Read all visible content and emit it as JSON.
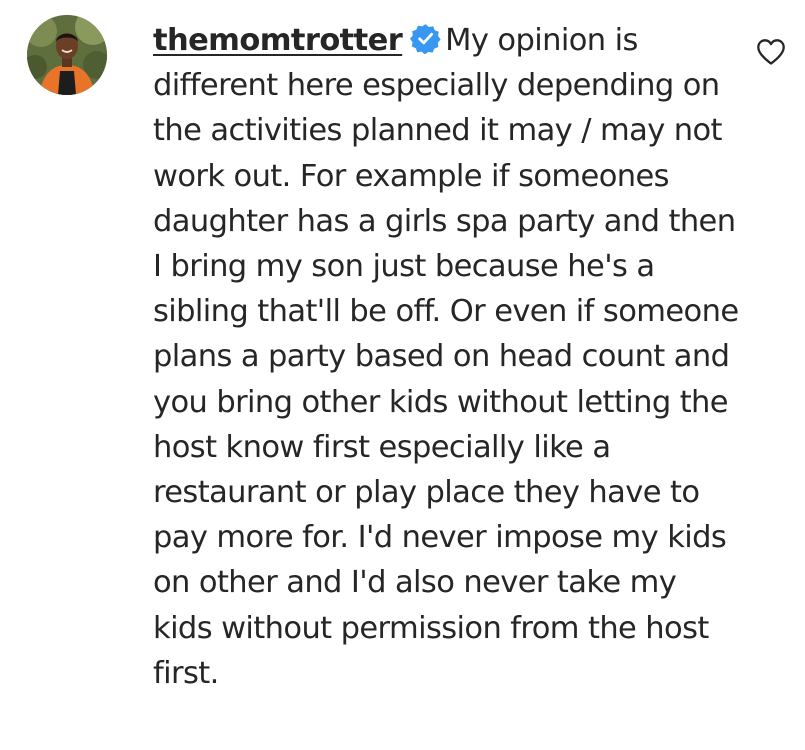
{
  "comment": {
    "username": "themomtrotter",
    "verified": true,
    "text": "My opinion is different here especially depending on the activities planned it may / may not work out. For example if someones daughter has a girls spa party and then I bring my son just because he's a sibling that'll be off. Or even if someone plans a party based on head count and you bring other kids without letting the host know first especially like a restaurant or play place they have to pay more for. I'd never impose my kids on other and I'd also never take my kids without permission from the host first.",
    "avatar_icon": "profile-photo",
    "verified_icon": "verified-badge-icon",
    "like_icon": "heart-outline-icon"
  },
  "colors": {
    "text": "#262626",
    "verified_blue": "#3897f0",
    "background": "#ffffff"
  }
}
